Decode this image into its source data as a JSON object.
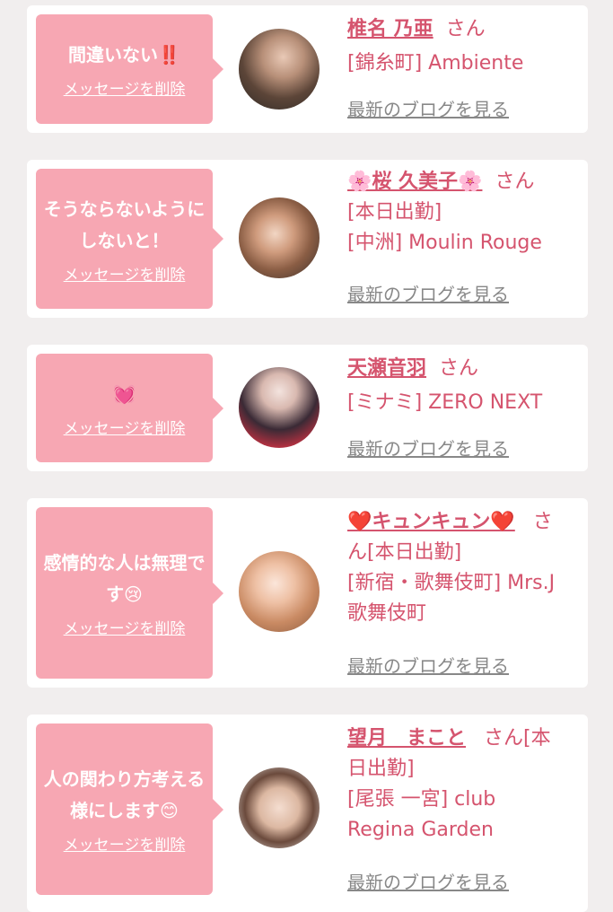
{
  "delete_label": "メッセージを削除",
  "blog_label": "最新のブログを見る",
  "san": "さん",
  "entries": [
    {
      "message": "間違いない‼️",
      "name": "椎名 乃亜",
      "shop_lines": [
        "[錦糸町] Ambiente"
      ]
    },
    {
      "message": "そうならないようにしないと！",
      "name": "🌸桜 久美子🌸",
      "shop_lines": [
        "[本日出勤]",
        "[中洲] Moulin Rouge"
      ]
    },
    {
      "message": "💓",
      "name": "天瀬音羽",
      "shop_lines": [
        "[ミナミ] ZERO NEXT"
      ]
    },
    {
      "message": "感情的な人は無理です😢",
      "name": "❤️キュンキュン❤️",
      "shop_lines": [
        "ん[本日出勤]",
        "[新宿・歌舞伎町] Mrs.J",
        "歌舞伎町"
      ],
      "san_wrapped": "さ"
    },
    {
      "message": "人の関わり方考える様にします😊",
      "name": "望月　まこと",
      "shop_lines": [
        "日出勤]",
        "[尾張 一宮] club",
        "Regina Garden"
      ],
      "san_wrapped": "さん[本"
    }
  ],
  "colors": {
    "background": "#f1eeee",
    "bubble": "#f7a7b3",
    "accent": "#d5546e",
    "link_gray": "#888888"
  },
  "icons": [
    "avatar-photo"
  ]
}
